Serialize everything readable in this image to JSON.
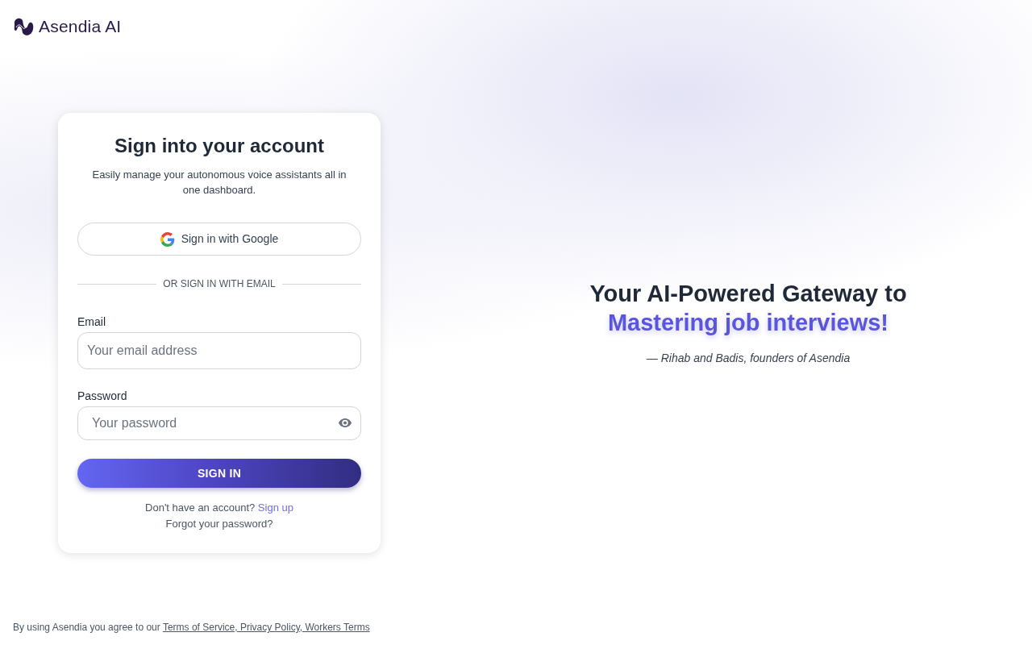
{
  "brand": {
    "name": "Asendia AI"
  },
  "signin_card": {
    "title": "Sign into your account",
    "subtitle": "Easily manage your autonomous voice assistants all in one dashboard.",
    "google_button": "Sign in with Google",
    "divider": "OR SIGN IN WITH EMAIL",
    "fields": [
      {
        "kind": "email",
        "label": "Email",
        "placeholder": "Your email address"
      },
      {
        "kind": "password",
        "label": "Password",
        "placeholder": "Your password"
      }
    ],
    "submit_button": "SIGN IN",
    "signup_prompt": "Don't have an account?",
    "signup_link": "Sign up",
    "forgot_link": "Forgot your password?"
  },
  "hero": {
    "headline": "Your AI-Powered Gateway to",
    "highlight": "Mastering job interviews!",
    "attribution": "— Rihab and Badis, founders of Asendia"
  },
  "footer": {
    "text": "By using Asendia you agree to our",
    "link": "Terms of Service, Privacy Policy, Workers Terms"
  }
}
